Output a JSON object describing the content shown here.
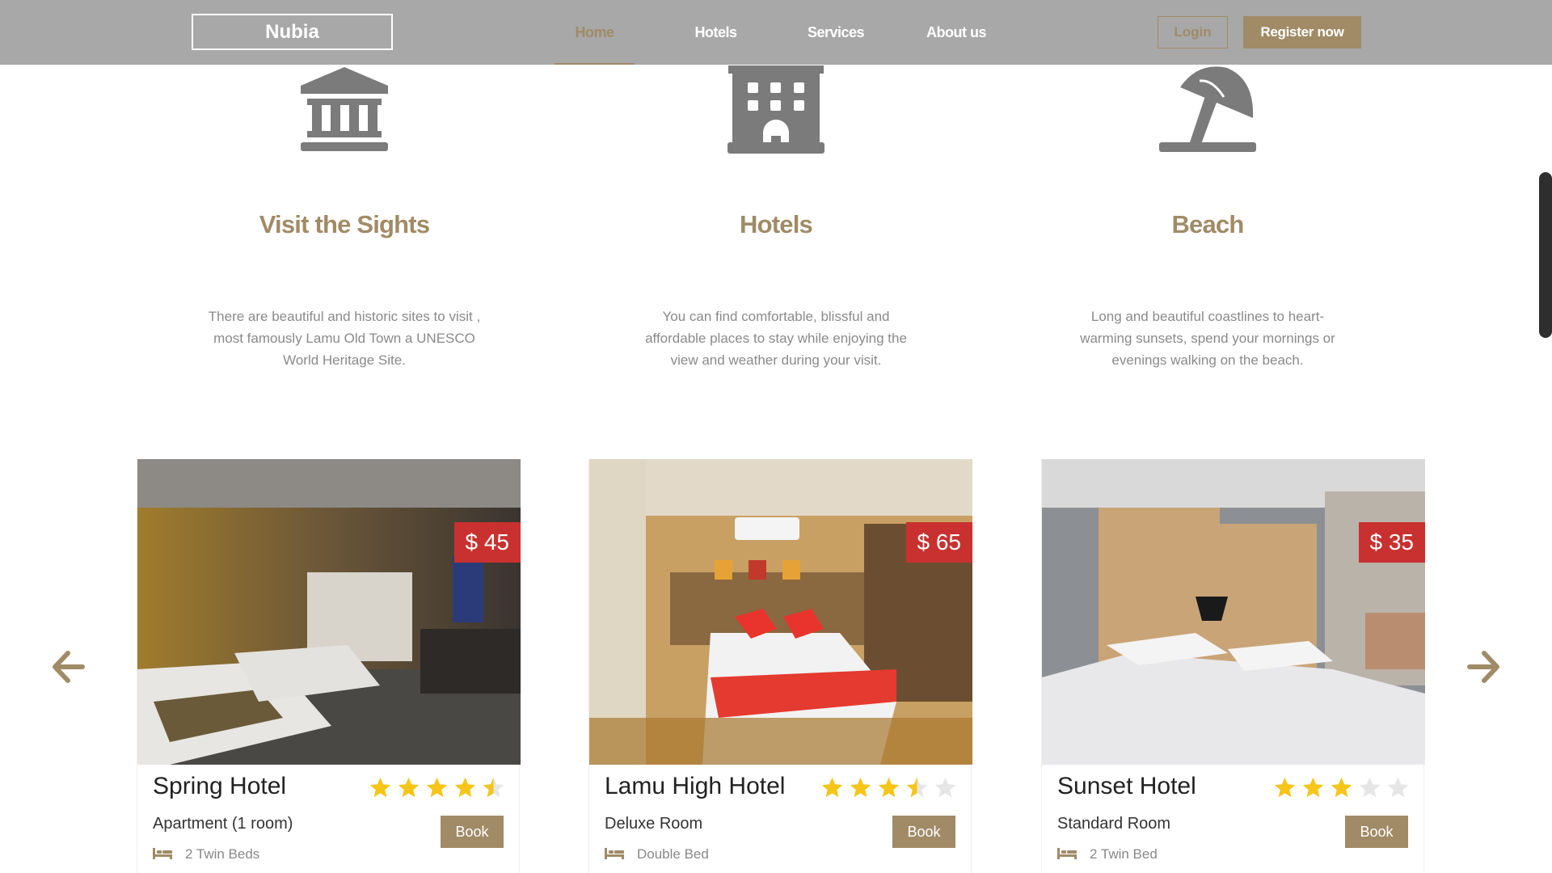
{
  "nav": {
    "brand": "Nubia",
    "links": [
      "Home",
      "Hotels",
      "Services",
      "About us"
    ],
    "active_link": "Home",
    "login": "Login",
    "register": "Register now"
  },
  "features": [
    {
      "icon": "landmark-icon",
      "title": "Visit the Sights",
      "text": "There are beautiful and historic sites to visit , most famously Lamu Old Town a UNESCO World Heritage Site."
    },
    {
      "icon": "hotel-building-icon",
      "title": "Hotels",
      "text": "You can find comfortable, blissful and affordable places to stay while enjoying the view and weather during your visit."
    },
    {
      "icon": "beach-umbrella-icon",
      "title": "Beach",
      "text": "Long and beautiful coastlines to heart-warming sunsets, spend your mornings or evenings walking on the beach."
    }
  ],
  "cards": [
    {
      "name": "Spring Hotel",
      "price": "$ 45",
      "rating": 4.5,
      "room": "Apartment (1 room)",
      "beds": "2 Twin Beds",
      "book": "Book"
    },
    {
      "name": "Lamu High Hotel",
      "price": "$ 65",
      "rating": 3.5,
      "room": "Deluxe Room",
      "beds": "Double Bed",
      "book": "Book"
    },
    {
      "name": "Sunset Hotel",
      "price": "$ 35",
      "rating": 3,
      "room": "Standard Room",
      "beds": "2 Twin Bed",
      "book": "Book"
    }
  ],
  "colors": {
    "accent": "#a08b66",
    "navbar": "#a8a8a8",
    "price_badge": "#c8312f",
    "star": "#f5c518",
    "star_empty": "#e6e6e6"
  }
}
